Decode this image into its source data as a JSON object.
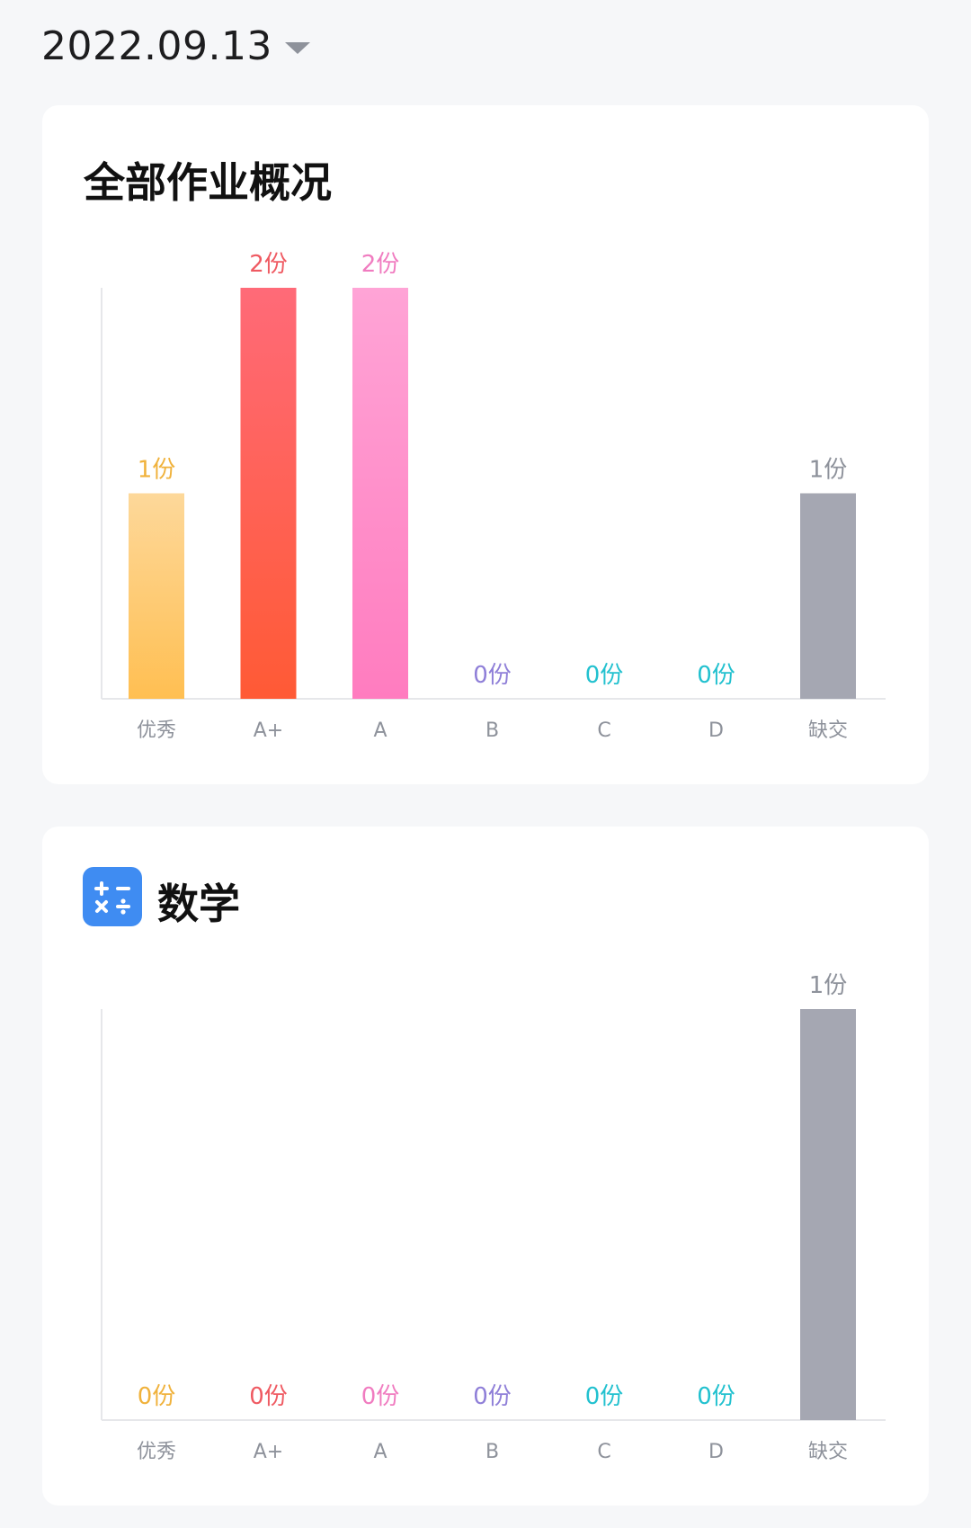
{
  "header": {
    "date": "2022.09.13"
  },
  "overview": {
    "title": "全部作业概况"
  },
  "math": {
    "title": "数学",
    "icon": "calculator-icon"
  },
  "colors": {
    "excellent": [
      "#fdd89a",
      "#ffbf52"
    ],
    "aplus": [
      "#ff6a78",
      "#ff5a35"
    ],
    "a": [
      "#ffa4d6",
      "#ff7cbf"
    ],
    "b": "#8f7fd8",
    "c": "#22c1cf",
    "d": "#22c1cf",
    "missing": [
      "#a5a7b2",
      "#a5a7b2"
    ],
    "label_excellent": "#f0b23c",
    "label_aplus": "#ef5a62",
    "label_a": "#f07cc0",
    "label_missing": "#8e929b"
  },
  "chart_data": [
    {
      "type": "bar",
      "title": "全部作业概况",
      "categories": [
        "优秀",
        "A+",
        "A",
        "B",
        "C",
        "D",
        "缺交"
      ],
      "values": [
        1,
        2,
        2,
        0,
        0,
        0,
        1
      ],
      "value_labels": [
        "1份",
        "2份",
        "2份",
        "0份",
        "0份",
        "0份",
        "1份"
      ],
      "ylim": [
        0,
        2
      ]
    },
    {
      "type": "bar",
      "title": "数学",
      "categories": [
        "优秀",
        "A+",
        "A",
        "B",
        "C",
        "D",
        "缺交"
      ],
      "values": [
        0,
        0,
        0,
        0,
        0,
        0,
        1
      ],
      "value_labels": [
        "0份",
        "0份",
        "0份",
        "0份",
        "0份",
        "0份",
        "1份"
      ],
      "ylim": [
        0,
        1
      ]
    }
  ]
}
